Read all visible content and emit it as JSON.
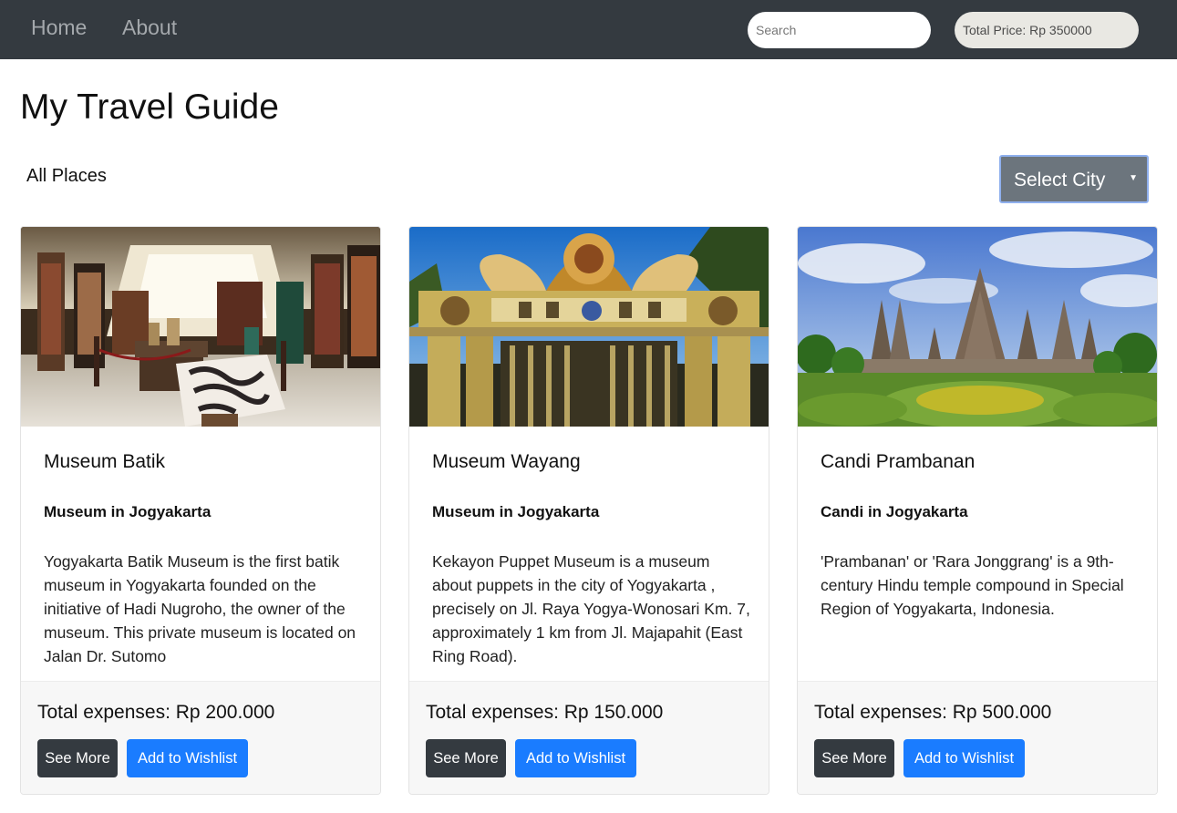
{
  "navbar": {
    "links": [
      {
        "label": "Home"
      },
      {
        "label": "About"
      }
    ],
    "search": {
      "placeholder": "Search",
      "value": ""
    },
    "total_price": "Total Price: Rp 350000"
  },
  "page": {
    "title": "My Travel Guide",
    "section_label": "All Places",
    "city_select": {
      "selected": "Select City"
    }
  },
  "cards": [
    {
      "title": "Museum Batik",
      "subtitle": "Museum in Jogyakarta",
      "description": "Yogyakarta Batik Museum is the first batik museum in Yogyakarta founded on the initiative of Hadi Nugroho, the owner of the museum. This private museum is located on Jalan Dr. Sutomo",
      "expense": "Total expenses: Rp 200.000",
      "see_more": "See More",
      "wishlist": "Add to Wishlist"
    },
    {
      "title": "Museum Wayang",
      "subtitle": "Museum in Jogyakarta",
      "description": "Kekayon Puppet Museum is a museum about puppets in the city of Yogyakarta , precisely on Jl. Raya Yogya-Wonosari Km. 7, approximately 1 km from Jl. Majapahit (East Ring Road).",
      "expense": "Total expenses: Rp 150.000",
      "see_more": "See More",
      "wishlist": "Add to Wishlist"
    },
    {
      "title": "Candi Prambanan",
      "subtitle": "Candi in Jogyakarta",
      "description": "'Prambanan' or 'Rara Jonggrang' is a 9th-century Hindu temple compound in Special Region of Yogyakarta, Indonesia.",
      "expense": "Total expenses: Rp 500.000",
      "see_more": "See More",
      "wishlist": "Add to Wishlist"
    }
  ],
  "colors": {
    "navbar": "#343a40",
    "nav_link": "#a4a8ac",
    "select_bg": "#6c757d",
    "primary": "#1a7cff",
    "dark_button": "#343a40",
    "footer_bg": "#f7f7f7"
  }
}
